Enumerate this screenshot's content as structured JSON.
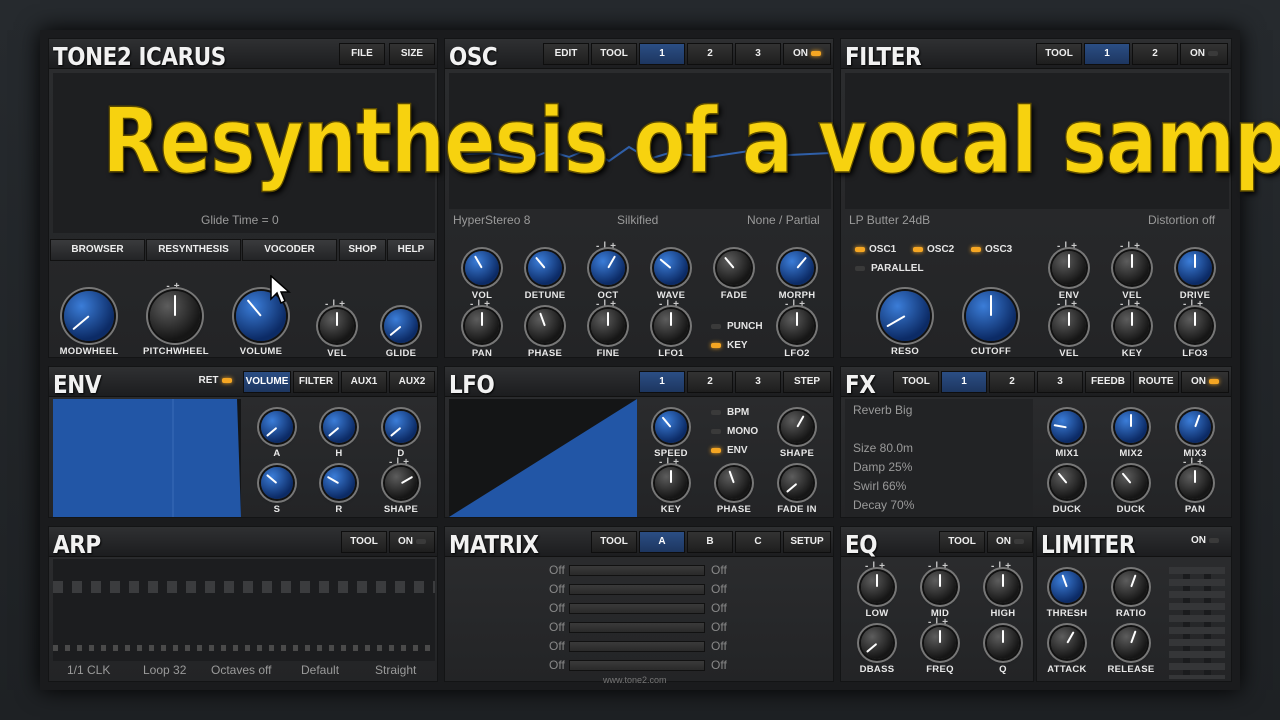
{
  "overlay_caption": "Resynthesis of a vocal sample",
  "footer_url": "www.tone2.com",
  "accent_color": "#f7d20f",
  "main": {
    "title": "TONE2  ICARUS",
    "buttons": [
      "FILE",
      "SIZE"
    ],
    "status": "Glide Time = 0",
    "nav": [
      "BROWSER",
      "RESYNTHESIS",
      "VOCODER",
      "SHOP",
      "HELP"
    ],
    "knobs": [
      "MODWHEEL",
      "PITCHWHEEL",
      "VOLUME",
      "VEL",
      "GLIDE"
    ]
  },
  "osc": {
    "title": "OSC",
    "buttons": [
      "EDIT",
      "TOOL",
      "1",
      "2",
      "3",
      "ON"
    ],
    "selected": "1",
    "info": [
      "HyperStereo 8",
      "Silkified",
      "None / Partial"
    ],
    "knobs_row1": [
      "VOL",
      "DETUNE",
      "OCT",
      "WAVE",
      "FADE",
      "MORPH"
    ],
    "knobs_row2": [
      "PAN",
      "PHASE",
      "FINE",
      "LFO1",
      "LFO2"
    ],
    "toggles": [
      "PUNCH",
      "KEY"
    ]
  },
  "filter": {
    "title": "FILTER",
    "buttons": [
      "TOOL",
      "1",
      "2",
      "ON"
    ],
    "selected": "1",
    "info": [
      "LP Butter 24dB",
      "Distortion off"
    ],
    "sources": [
      "OSC1",
      "OSC2",
      "OSC3"
    ],
    "parallel_label": "PARALLEL",
    "big_knobs": [
      "RESO",
      "CUTOFF"
    ],
    "knobs_row1": [
      "ENV",
      "VEL",
      "DRIVE"
    ],
    "knobs_row2": [
      "VEL",
      "KEY",
      "LFO3"
    ]
  },
  "env": {
    "title": "ENV",
    "ret_label": "RET",
    "tabs": [
      "VOLUME",
      "FILTER",
      "AUX1",
      "AUX2"
    ],
    "selected": "VOLUME",
    "knobs": [
      "A",
      "H",
      "D",
      "S",
      "R",
      "SHAPE"
    ]
  },
  "lfo": {
    "title": "LFO",
    "tabs": [
      "1",
      "2",
      "3",
      "STEP"
    ],
    "selected": "1",
    "toggles": [
      "BPM",
      "MONO",
      "ENV"
    ],
    "knobs": [
      "SPEED",
      "SHAPE",
      "KEY",
      "PHASE",
      "FADE IN"
    ]
  },
  "fx": {
    "title": "FX",
    "buttons": [
      "TOOL",
      "1",
      "2",
      "3",
      "FEEDB",
      "ROUTE",
      "ON"
    ],
    "selected": "1",
    "preset": "Reverb Big",
    "params": [
      "Size 80.0m",
      "Damp 25%",
      "Swirl 66%",
      "Decay 70%"
    ],
    "knobs": [
      "MIX1",
      "MIX2",
      "MIX3",
      "DUCK",
      "DUCK",
      "PAN"
    ]
  },
  "arp": {
    "title": "ARP",
    "buttons": [
      "TOOL",
      "ON"
    ],
    "footer": [
      "1/1 CLK",
      "Loop 32",
      "Octaves off",
      "Default",
      "Straight"
    ]
  },
  "matrix": {
    "title": "MATRIX",
    "buttons": [
      "TOOL",
      "A",
      "B",
      "C",
      "SETUP"
    ],
    "selected": "A",
    "rows": [
      {
        "src": "Off",
        "dst": "Off"
      },
      {
        "src": "Off",
        "dst": "Off"
      },
      {
        "src": "Off",
        "dst": "Off"
      },
      {
        "src": "Off",
        "dst": "Off"
      },
      {
        "src": "Off",
        "dst": "Off"
      },
      {
        "src": "Off",
        "dst": "Off"
      }
    ]
  },
  "eq": {
    "title": "EQ",
    "buttons": [
      "TOOL",
      "ON"
    ],
    "knobs": [
      "LOW",
      "MID",
      "HIGH",
      "DBASS",
      "FREQ",
      "Q"
    ]
  },
  "limiter": {
    "title": "LIMITER",
    "on_label": "ON",
    "knobs": [
      "THRESH",
      "RATIO",
      "ATTACK",
      "RELEASE"
    ]
  }
}
